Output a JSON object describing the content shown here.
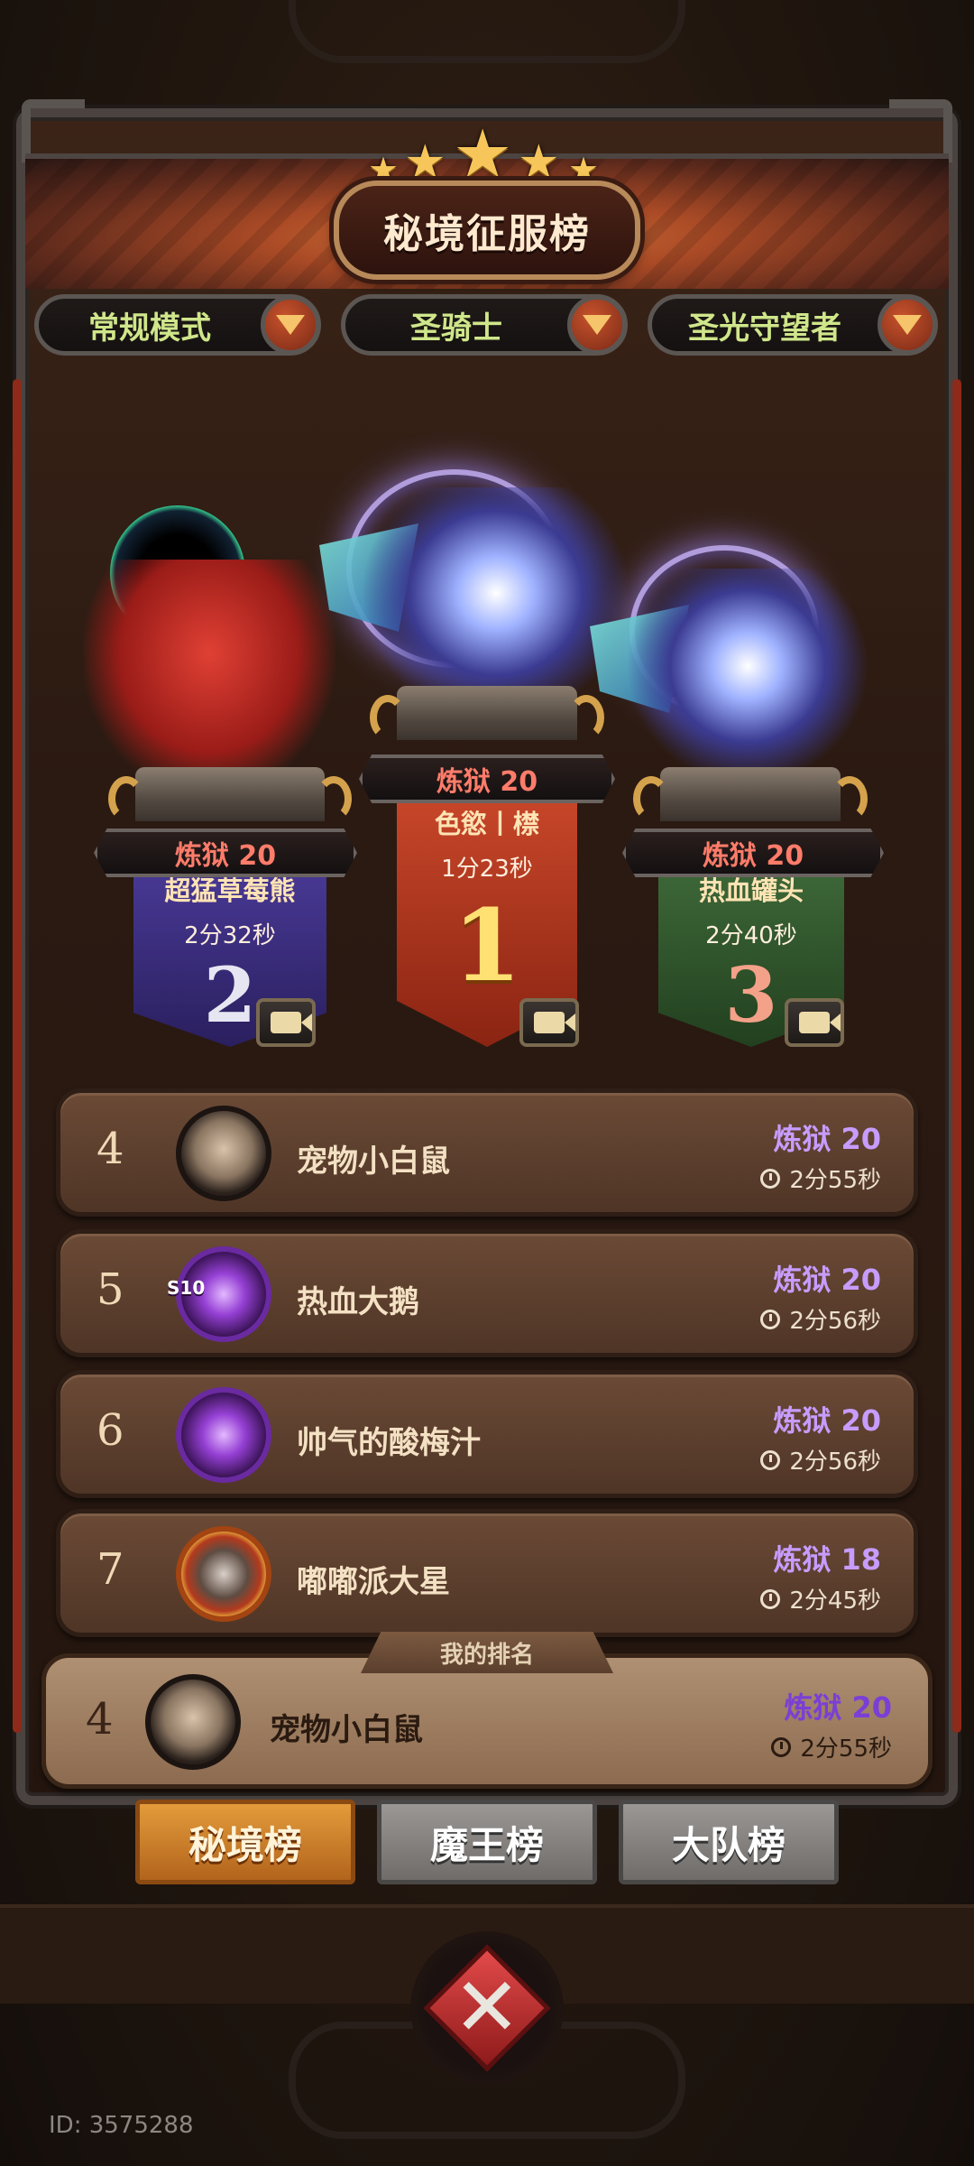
{
  "header": {
    "title": "秘境征服榜"
  },
  "filters": [
    {
      "label": "常规模式"
    },
    {
      "label": "圣骑士"
    },
    {
      "label": "圣光守望者"
    }
  ],
  "podium": [
    {
      "rank": "1",
      "difficulty": "炼狱 20",
      "name": "色慾丨㯲",
      "time": "1分23秒",
      "color": "#b5401e"
    },
    {
      "rank": "2",
      "difficulty": "炼狱 20",
      "name": "超猛草莓熊",
      "time": "2分32秒",
      "color": "#3b2e7a"
    },
    {
      "rank": "3",
      "difficulty": "炼狱 20",
      "name": "热血罐头",
      "time": "2分40秒",
      "color": "#2e5a2c"
    }
  ],
  "ranking": [
    {
      "rank": "4",
      "name": "宠物小白鼠",
      "difficulty": "炼狱 20",
      "time": "2分55秒"
    },
    {
      "rank": "5",
      "name": "热血大鹅",
      "difficulty": "炼狱 20",
      "time": "2分56秒",
      "badge": "S10"
    },
    {
      "rank": "6",
      "name": "帅气的酸梅汁",
      "difficulty": "炼狱 20",
      "time": "2分56秒"
    },
    {
      "rank": "7",
      "name": "嘟嘟派大星",
      "difficulty": "炼狱 18",
      "time": "2分45秒"
    }
  ],
  "my_rank": {
    "label": "我的排名",
    "rank": "4",
    "name": "宠物小白鼠",
    "difficulty": "炼狱 20",
    "time": "2分55秒"
  },
  "tabs": [
    {
      "label": "秘境榜",
      "active": true
    },
    {
      "label": "魔王榜",
      "active": false
    },
    {
      "label": "大队榜",
      "active": false
    }
  ],
  "footer": {
    "id_text": "ID: 3575288"
  }
}
